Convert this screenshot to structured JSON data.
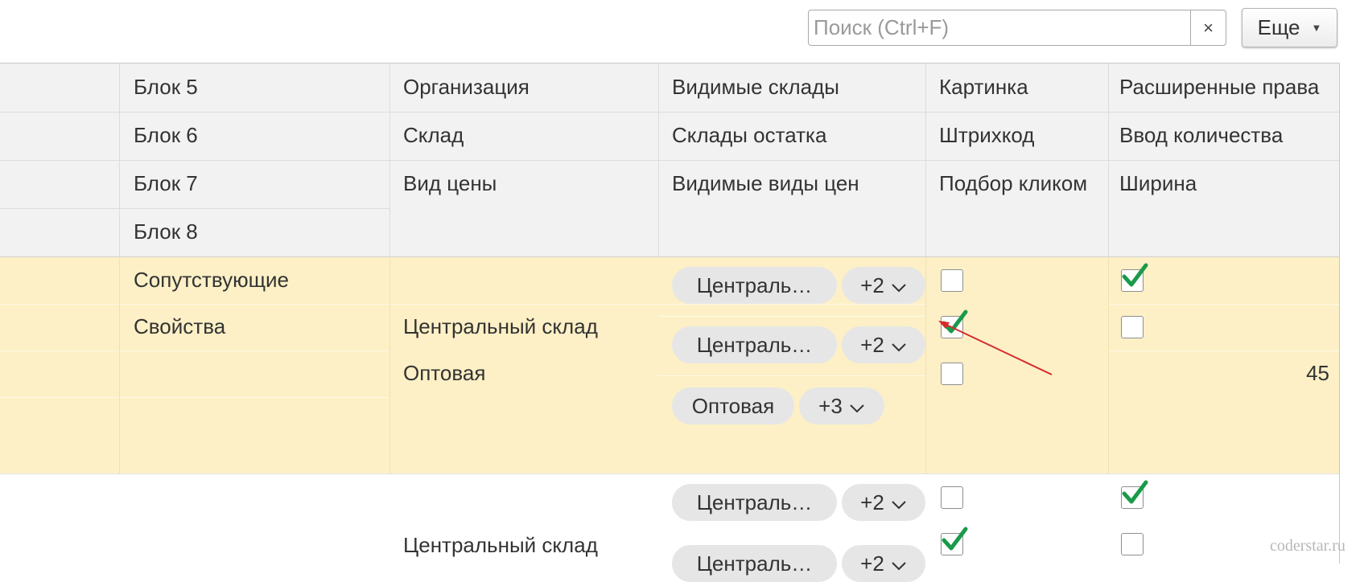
{
  "toolbar": {
    "search_placeholder": "Поиск (Ctrl+F)",
    "clear_symbol": "×",
    "more_label": "Еще",
    "more_caret": "▼"
  },
  "header": {
    "col_block": [
      "Блок 5",
      "Блок 6",
      "Блок 7",
      "Блок 8"
    ],
    "col_org": [
      "Организация",
      "Склад",
      "Вид цены"
    ],
    "col_warehouses": [
      "Видимые склады",
      "Склады остатка",
      "Видимые виды цен"
    ],
    "col_picture": [
      "Картинка",
      "Штрихкод",
      "Подбор кликом"
    ],
    "col_rights": [
      "Расширенные права",
      "Ввод количества",
      "Ширина"
    ]
  },
  "rows": [
    {
      "block_lines": [
        "Сопутствующие",
        "Свойства"
      ],
      "org_lines": [
        "Центральный склад",
        "Оптовая"
      ],
      "chips": [
        {
          "label": "Централь…",
          "more": "+2"
        },
        {
          "label": "Централь…",
          "more": "+2"
        },
        {
          "label": "Оптовая",
          "more": "+3"
        }
      ],
      "picture_checks": [
        false,
        true,
        false
      ],
      "rights_checks": [
        true,
        false
      ],
      "width_value": "45"
    },
    {
      "org_lines": [
        "Центральный склад"
      ],
      "chips": [
        {
          "label": "Централь…",
          "more": "+2"
        },
        {
          "label": "Централь…",
          "more": "+2"
        }
      ],
      "picture_checks": [
        false,
        true
      ],
      "rights_checks": [
        true,
        false
      ]
    }
  ],
  "watermark": "coderstar.ru",
  "colors": {
    "selected_row": "#fdf0c6",
    "header_bg": "#f2f2f2",
    "check_green": "#1a9a4a",
    "arrow_red": "#d62a2a"
  }
}
